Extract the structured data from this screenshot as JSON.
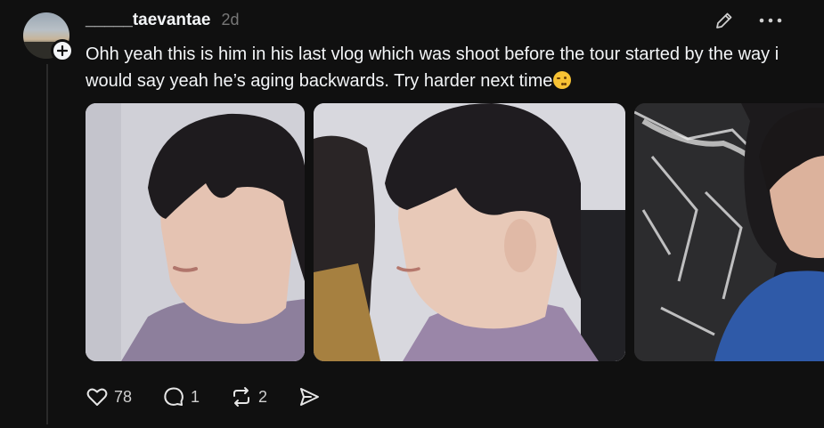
{
  "post": {
    "username": "_____taevantae",
    "timestamp": "2d",
    "text": "Ohh yeah this is him in his last vlog which was shoot before the tour started by the way i would say yeah he’s aging backwards. Try harder next time",
    "emoji_icon": "winking-face-emoji"
  },
  "icons": {
    "edit": "pencil-icon",
    "more": "more-horizontal-icon",
    "add": "plus-icon"
  },
  "media": [
    {
      "alt": "photo-1"
    },
    {
      "alt": "photo-2"
    },
    {
      "alt": "photo-3"
    }
  ],
  "actions": {
    "likes": "78",
    "replies": "1",
    "reposts": "2"
  },
  "colors": {
    "background": "#101010",
    "text": "#f3f5f7",
    "muted": "#777777"
  }
}
